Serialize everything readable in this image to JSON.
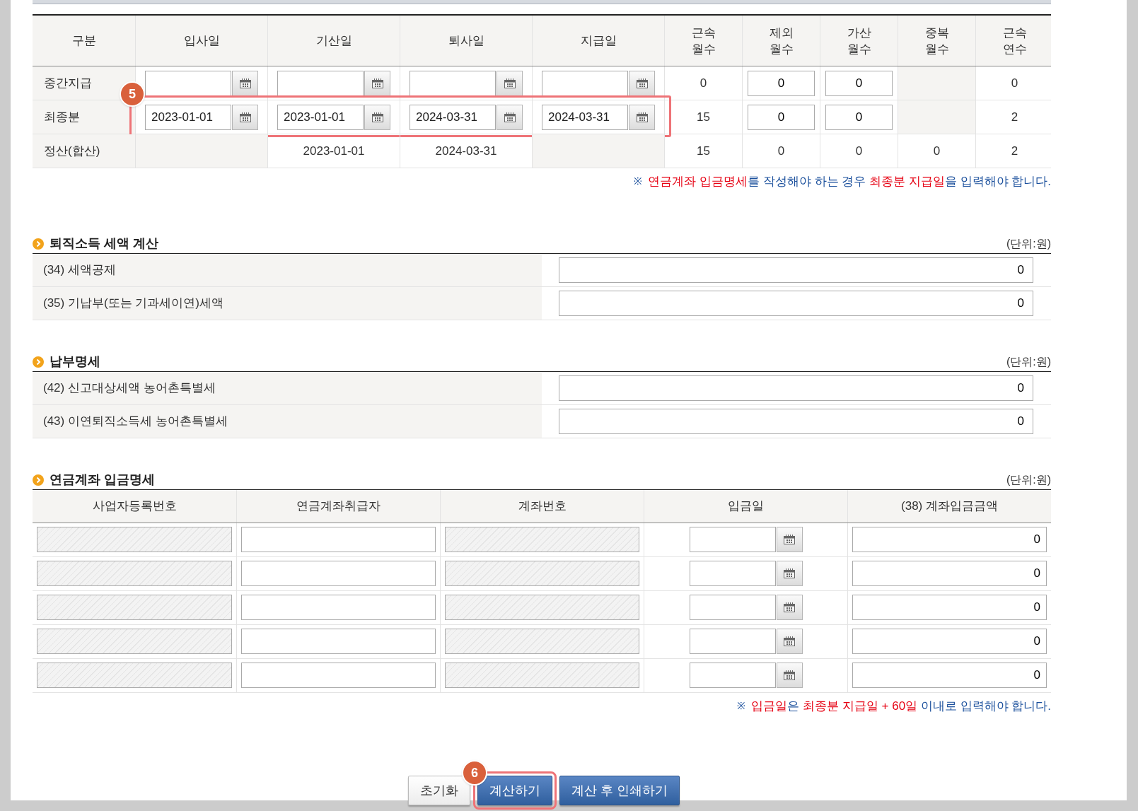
{
  "period_table": {
    "columns": [
      {
        "label": "구분"
      },
      {
        "label": "입사일"
      },
      {
        "label": "기산일"
      },
      {
        "label": "퇴사일"
      },
      {
        "label": "지급일"
      },
      {
        "label": "근속\n월수"
      },
      {
        "label": "제외\n월수"
      },
      {
        "label": "가산\n월수"
      },
      {
        "label": "중복\n월수"
      },
      {
        "label": "근속\n연수"
      }
    ],
    "rows": [
      {
        "cells": [
          {
            "kind": "label",
            "value": "중간지급"
          },
          {
            "kind": "date"
          },
          {
            "kind": "date"
          },
          {
            "kind": "date"
          },
          {
            "kind": "date"
          },
          {
            "kind": "text",
            "value": "0"
          },
          {
            "kind": "number",
            "value": "0"
          },
          {
            "kind": "number",
            "value": "0"
          },
          {
            "kind": "blank"
          },
          {
            "kind": "text",
            "value": "0"
          }
        ]
      },
      {
        "badge": "5",
        "cells": [
          {
            "kind": "label",
            "value": "최종분"
          },
          {
            "kind": "date",
            "value": "2023-01-01"
          },
          {
            "kind": "date",
            "value": "2023-01-01"
          },
          {
            "kind": "date",
            "value": "2024-03-31"
          },
          {
            "kind": "date",
            "value": "2024-03-31"
          },
          {
            "kind": "text",
            "value": "15"
          },
          {
            "kind": "number",
            "value": "0"
          },
          {
            "kind": "number",
            "value": "0"
          },
          {
            "kind": "blank"
          },
          {
            "kind": "text",
            "value": "2"
          }
        ]
      },
      {
        "cells": [
          {
            "kind": "label",
            "value": "정산(합산)"
          },
          {
            "kind": "blank"
          },
          {
            "kind": "text",
            "value": "2023-01-01"
          },
          {
            "kind": "text",
            "value": "2024-03-31"
          },
          {
            "kind": "blank"
          },
          {
            "kind": "text",
            "value": "15"
          },
          {
            "kind": "text",
            "value": "0"
          },
          {
            "kind": "text",
            "value": "0"
          },
          {
            "kind": "text",
            "value": "0"
          },
          {
            "kind": "text",
            "value": "2"
          }
        ]
      }
    ],
    "notice": {
      "mark": "※",
      "segments": [
        {
          "text": "연금계좌 입금명세",
          "emphasis": true
        },
        {
          "text": "를 작성해야 하는 경우 ",
          "emphasis": false
        },
        {
          "text": "최종분 지급일",
          "emphasis": true
        },
        {
          "text": "을 입력해야 합니다.",
          "emphasis": false
        }
      ]
    }
  },
  "sections": [
    {
      "title": "퇴직소득 세액 계산",
      "unit": "(단위:원)",
      "rows": [
        {
          "label": "(34) 세액공제",
          "value": "0"
        },
        {
          "label": "(35) 기납부(또는 기과세이연)세액",
          "value": "0"
        }
      ]
    },
    {
      "title": "납부명세",
      "unit": "(단위:원)",
      "rows": [
        {
          "label": "(42) 신고대상세액 농어촌특별세",
          "value": "0"
        },
        {
          "label": "(43) 이연퇴직소득세 농어촌특별세",
          "value": "0"
        }
      ]
    }
  ],
  "deposit": {
    "title": "연금계좌 입금명세",
    "unit": "(단위:원)",
    "columns": [
      "사업자등록번호",
      "연금계좌취급자",
      "계좌번호",
      "입금일",
      "(38) 계좌입금금액"
    ],
    "rows": [
      {
        "cells": [
          {
            "kind": "field",
            "disabled": true
          },
          {
            "kind": "field",
            "disabled": false
          },
          {
            "kind": "field",
            "disabled": true
          },
          {
            "kind": "date"
          },
          {
            "kind": "amount",
            "value": "0"
          }
        ]
      },
      {
        "cells": [
          {
            "kind": "field",
            "disabled": true
          },
          {
            "kind": "field",
            "disabled": false
          },
          {
            "kind": "field",
            "disabled": true
          },
          {
            "kind": "date"
          },
          {
            "kind": "amount",
            "value": "0"
          }
        ]
      },
      {
        "cells": [
          {
            "kind": "field",
            "disabled": true
          },
          {
            "kind": "field",
            "disabled": false
          },
          {
            "kind": "field",
            "disabled": true
          },
          {
            "kind": "date"
          },
          {
            "kind": "amount",
            "value": "0"
          }
        ]
      },
      {
        "cells": [
          {
            "kind": "field",
            "disabled": true
          },
          {
            "kind": "field",
            "disabled": false
          },
          {
            "kind": "field",
            "disabled": true
          },
          {
            "kind": "date"
          },
          {
            "kind": "amount",
            "value": "0"
          }
        ]
      },
      {
        "cells": [
          {
            "kind": "field",
            "disabled": true
          },
          {
            "kind": "field",
            "disabled": false
          },
          {
            "kind": "field",
            "disabled": true
          },
          {
            "kind": "date"
          },
          {
            "kind": "amount",
            "value": "0"
          }
        ]
      }
    ],
    "notice": {
      "mark": "※",
      "segments": [
        {
          "text": "입금일",
          "emphasis": true
        },
        {
          "text": "은 ",
          "emphasis": false
        },
        {
          "text": "최종분 지급일 + 60일",
          "emphasis": true
        },
        {
          "text": " 이내로 입력해야 합니다.",
          "emphasis": false
        }
      ]
    }
  },
  "buttons": [
    {
      "label": "초기화",
      "kind": "plain"
    },
    {
      "label": "계산하기",
      "kind": "primary",
      "badge": "6"
    },
    {
      "label": "계산 후 인쇄하기",
      "kind": "primary"
    }
  ]
}
